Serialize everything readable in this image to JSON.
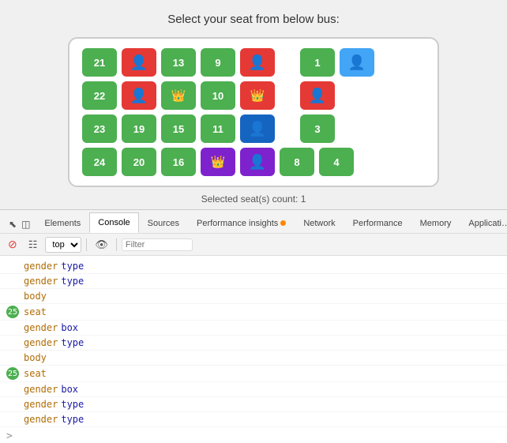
{
  "page": {
    "title": "Select your seat from below bus:"
  },
  "bus": {
    "seats": [
      {
        "id": "21",
        "type": "number",
        "color": "green",
        "row": 1,
        "col": 1
      },
      {
        "id": "person1",
        "type": "person",
        "color": "red",
        "row": 1,
        "col": 2
      },
      {
        "id": "13",
        "type": "number",
        "color": "green",
        "row": 1,
        "col": 3
      },
      {
        "id": "9",
        "type": "number",
        "color": "green",
        "row": 1,
        "col": 4
      },
      {
        "id": "person2",
        "type": "person",
        "color": "red",
        "row": 1,
        "col": 5
      },
      {
        "id": "1",
        "type": "number",
        "color": "green",
        "row": 1,
        "col": 7
      },
      {
        "id": "person-selected",
        "type": "person-selected",
        "color": "blue",
        "row": 1,
        "col": 8
      },
      {
        "id": "22",
        "type": "number",
        "color": "green",
        "row": 2,
        "col": 1
      },
      {
        "id": "person3",
        "type": "person",
        "color": "red",
        "row": 2,
        "col": 2
      },
      {
        "id": "crown1",
        "type": "crown",
        "color": "green",
        "row": 2,
        "col": 3
      },
      {
        "id": "10",
        "type": "number",
        "color": "green",
        "row": 2,
        "col": 4
      },
      {
        "id": "crown2",
        "type": "crown",
        "color": "red",
        "row": 2,
        "col": 5
      },
      {
        "id": "person4",
        "type": "person",
        "color": "red",
        "row": 2,
        "col": 7
      },
      {
        "id": "23",
        "type": "number",
        "color": "green",
        "row": 3,
        "col": 1
      },
      {
        "id": "19",
        "type": "number",
        "color": "green",
        "row": 3,
        "col": 2
      },
      {
        "id": "15",
        "type": "number",
        "color": "green",
        "row": 3,
        "col": 3
      },
      {
        "id": "11",
        "type": "number",
        "color": "green",
        "row": 3,
        "col": 4
      },
      {
        "id": "person5",
        "type": "person",
        "color": "blue-dark",
        "row": 3,
        "col": 5
      },
      {
        "id": "3",
        "type": "number",
        "color": "green",
        "row": 3,
        "col": 7
      },
      {
        "id": "24",
        "type": "number",
        "color": "green",
        "row": 4,
        "col": 1
      },
      {
        "id": "20",
        "type": "number",
        "color": "green",
        "row": 4,
        "col": 2
      },
      {
        "id": "16",
        "type": "number",
        "color": "green",
        "row": 4,
        "col": 3
      },
      {
        "id": "crown3",
        "type": "crown",
        "color": "purple",
        "row": 4,
        "col": 4
      },
      {
        "id": "person6",
        "type": "person",
        "color": "purple",
        "row": 4,
        "col": 5
      },
      {
        "id": "8",
        "type": "number",
        "color": "green",
        "row": 4,
        "col": 6
      },
      {
        "id": "4",
        "type": "number",
        "color": "green",
        "row": 4,
        "col": 7
      }
    ],
    "selected_count": "Selected seat(s) count: 1"
  },
  "devtools": {
    "tabs": [
      {
        "label": "Elements",
        "active": false
      },
      {
        "label": "Console",
        "active": true
      },
      {
        "label": "Sources",
        "active": false
      },
      {
        "label": "Performance insights",
        "active": false,
        "has_dot": true
      },
      {
        "label": "Network",
        "active": false
      },
      {
        "label": "Performance",
        "active": false
      },
      {
        "label": "Memory",
        "active": false
      },
      {
        "label": "Applicati…",
        "active": false
      }
    ],
    "toolbar": {
      "context": "top",
      "filter_placeholder": "Filter"
    },
    "console_rows": [
      {
        "type": "log",
        "indent": true,
        "content": [
          {
            "key": "gender",
            "val": "type"
          }
        ]
      },
      {
        "type": "log",
        "indent": true,
        "content": [
          {
            "key": "gender",
            "val": "type"
          }
        ]
      },
      {
        "type": "log",
        "indent": true,
        "content": [
          {
            "key": "body",
            "val": ""
          }
        ]
      },
      {
        "type": "badge",
        "badge": "25",
        "badge_color": "green",
        "content": [
          {
            "key": "seat",
            "val": ""
          }
        ]
      },
      {
        "type": "log",
        "indent": true,
        "content": [
          {
            "key": "gender",
            "val": "box"
          }
        ]
      },
      {
        "type": "log",
        "indent": true,
        "content": [
          {
            "key": "gender",
            "val": "type"
          }
        ]
      },
      {
        "type": "log",
        "indent": true,
        "content": [
          {
            "key": "body",
            "val": ""
          }
        ]
      },
      {
        "type": "badge",
        "badge": "25",
        "badge_color": "green",
        "content": [
          {
            "key": "seat",
            "val": ""
          }
        ]
      },
      {
        "type": "log",
        "indent": true,
        "content": [
          {
            "key": "gender",
            "val": "box"
          }
        ]
      },
      {
        "type": "log",
        "indent": true,
        "content": [
          {
            "key": "gender",
            "val": "type"
          }
        ]
      },
      {
        "type": "log",
        "indent": true,
        "content": [
          {
            "key": "gender",
            "val": "type"
          }
        ]
      }
    ]
  }
}
